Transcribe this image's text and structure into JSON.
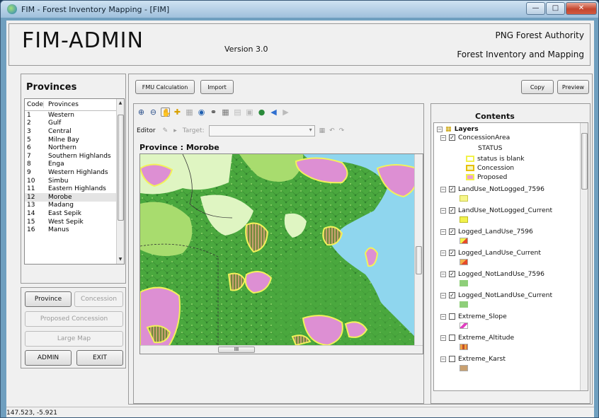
{
  "window": {
    "title": "FIM - Forest Inventory Mapping - [FIM]"
  },
  "header": {
    "app_title": "FIM-ADMIN",
    "version": "Version 3.0",
    "org_line1": "PNG Forest Authority",
    "org_line2": "Forest Inventory and Mapping"
  },
  "provinces": {
    "panel_title": "Provinces",
    "col_code": "Code",
    "col_name": "Provinces",
    "rows": [
      {
        "code": "1",
        "name": "Western"
      },
      {
        "code": "2",
        "name": "Gulf"
      },
      {
        "code": "3",
        "name": "Central"
      },
      {
        "code": "5",
        "name": "Milne Bay"
      },
      {
        "code": "6",
        "name": "Northern"
      },
      {
        "code": "7",
        "name": "Southern Highlands"
      },
      {
        "code": "8",
        "name": "Enga"
      },
      {
        "code": "9",
        "name": "Western Highlands"
      },
      {
        "code": "10",
        "name": "Simbu"
      },
      {
        "code": "11",
        "name": "Eastern Highlands"
      },
      {
        "code": "12",
        "name": "Morobe"
      },
      {
        "code": "13",
        "name": "Madang"
      },
      {
        "code": "14",
        "name": "East Sepik"
      },
      {
        "code": "15",
        "name": "West Sepik"
      },
      {
        "code": "16",
        "name": "Manus"
      }
    ],
    "selected": "Morobe"
  },
  "nav_buttons": {
    "province": "Province",
    "concession": "Concession",
    "proposed_concession": "Proposed Concession",
    "large_map": "Large Map",
    "admin": "ADMIN",
    "exit": "EXIT"
  },
  "toolbar": {
    "fmu_calculation": "FMU Calculation",
    "import": "Import",
    "copy": "Copy",
    "preview": "Preview"
  },
  "editor": {
    "label": "Editor",
    "target_label": "Target:"
  },
  "map": {
    "province_label": "Province : Morobe",
    "hscroll_grip": "III"
  },
  "contents": {
    "title": "Contents",
    "root": "Layers",
    "layers": [
      {
        "name": "ConcessionArea",
        "checked": true
      },
      {
        "name": "LandUse_NotLogged_7596",
        "checked": true
      },
      {
        "name": "LandUse_NotLogged_Current",
        "checked": true
      },
      {
        "name": "Logged_LandUse_7596",
        "checked": true
      },
      {
        "name": "Logged_LandUse_Current",
        "checked": true
      },
      {
        "name": "Logged_NotLandUse_7596",
        "checked": true
      },
      {
        "name": "Logged_NotLandUse_Current",
        "checked": true
      },
      {
        "name": "Extreme_Slope",
        "checked": false
      },
      {
        "name": "Extreme_Altitude",
        "checked": false
      },
      {
        "name": "Extreme_Karst",
        "checked": false
      }
    ],
    "legend_status": "STATUS",
    "legend_items": [
      "status is blank",
      "Concession",
      "Proposed"
    ]
  },
  "colors": {
    "forest": "#4aa83e",
    "grass": "#a8dc6e",
    "pale": "#dff5c2",
    "sea": "#8fd6ee",
    "proposed": "#dd8fd3",
    "boundary": "#f2f25a"
  },
  "statusbar": {
    "coords": "147.523, -5.921"
  }
}
